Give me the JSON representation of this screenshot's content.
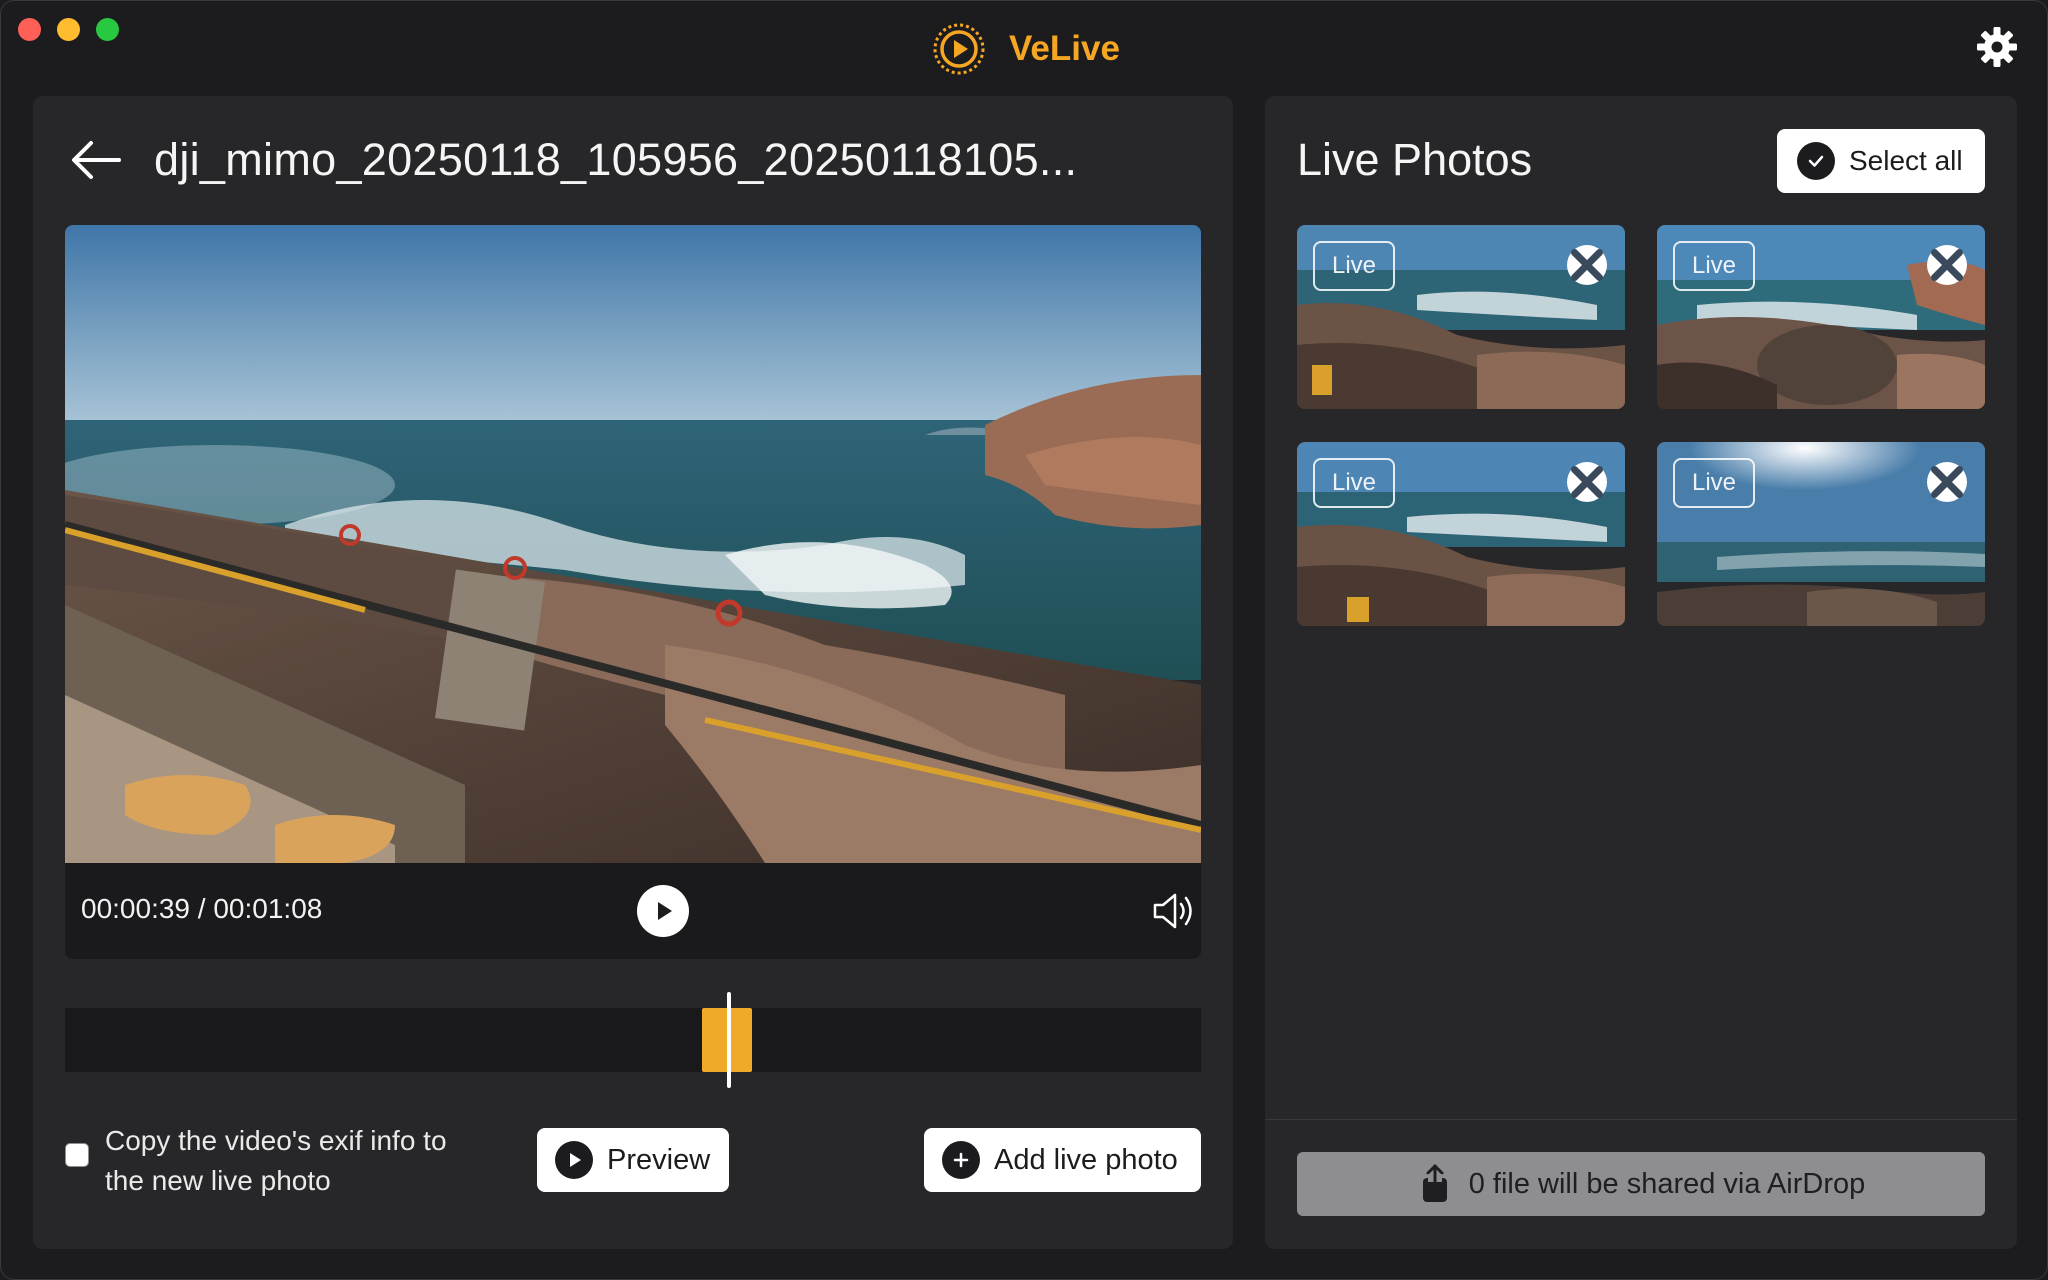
{
  "app": {
    "name": "VeLive"
  },
  "header": {
    "file_title": "dji_mimo_20250118_105956_20250118105..."
  },
  "player": {
    "current_time": "00:00:39",
    "separator": " / ",
    "total_time": "00:01:08",
    "progress_fraction": 0.574
  },
  "options": {
    "copy_exif_label": "Copy the video's exif info to the new live photo",
    "copy_exif_checked": false
  },
  "buttons": {
    "preview": "Preview",
    "add_live_photo": "Add live photo",
    "select_all": "Select all"
  },
  "live_photos": {
    "title": "Live Photos",
    "items": [
      {
        "badge": "Live"
      },
      {
        "badge": "Live"
      },
      {
        "badge": "Live"
      },
      {
        "badge": "Live"
      }
    ]
  },
  "share": {
    "label": "0 file will be shared via AirDrop"
  },
  "colors": {
    "accent": "#f5a623",
    "background": "#1c1c1e",
    "panel": "#272729"
  },
  "icons": [
    "velive-logo-icon",
    "gear-icon",
    "back-arrow-icon",
    "play-icon",
    "volume-icon",
    "checkmark-icon",
    "plus-icon",
    "close-icon",
    "share-icon"
  ]
}
